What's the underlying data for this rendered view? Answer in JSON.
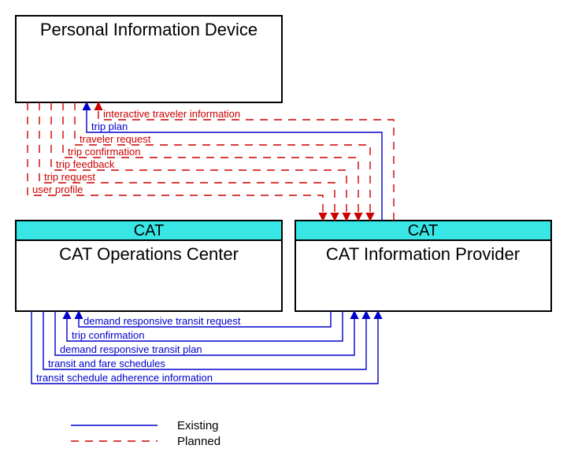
{
  "nodes": {
    "pid": {
      "title": "Personal Information Device"
    },
    "ops": {
      "org": "CAT",
      "title": "CAT Operations Center"
    },
    "info": {
      "org": "CAT",
      "title": "CAT Information Provider"
    }
  },
  "flows_top": [
    {
      "label": "interactive traveler information",
      "status": "planned",
      "dir": "to_pid"
    },
    {
      "label": "trip plan",
      "status": "existing",
      "dir": "to_pid"
    },
    {
      "label": "traveler request",
      "status": "planned",
      "dir": "to_info"
    },
    {
      "label": "trip confirmation",
      "status": "planned",
      "dir": "to_info"
    },
    {
      "label": "trip feedback",
      "status": "planned",
      "dir": "to_info"
    },
    {
      "label": "trip request",
      "status": "planned",
      "dir": "to_info"
    },
    {
      "label": "user profile",
      "status": "planned",
      "dir": "to_info"
    }
  ],
  "flows_bottom": [
    {
      "label": "demand responsive transit request",
      "status": "existing",
      "dir": "to_ops"
    },
    {
      "label": "trip confirmation",
      "status": "existing",
      "dir": "to_ops"
    },
    {
      "label": "demand responsive transit plan",
      "status": "existing",
      "dir": "to_info"
    },
    {
      "label": "transit and fare schedules",
      "status": "existing",
      "dir": "to_info"
    },
    {
      "label": "transit schedule adherence information",
      "status": "existing",
      "dir": "to_info"
    }
  ],
  "legend": {
    "existing": "Existing",
    "planned": "Planned"
  }
}
